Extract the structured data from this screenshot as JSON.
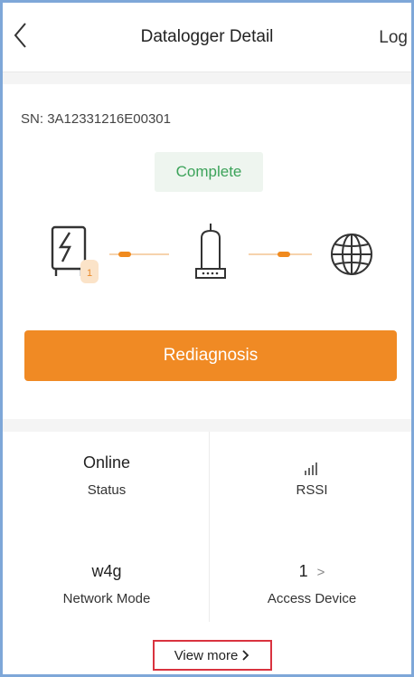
{
  "header": {
    "title": "Datalogger Detail",
    "right_action": "Log",
    "back_icon": "chevron-left-icon"
  },
  "device": {
    "sn_label": "SN:",
    "sn_value": "3A12331216E00301",
    "status_badge": "Complete"
  },
  "diagram": {
    "inverter_icon": "inverter-icon",
    "inverter_badge": "1",
    "datalogger_icon": "datalogger-icon",
    "internet_icon": "globe-icon"
  },
  "actions": {
    "rediagnosis": "Rediagnosis",
    "view_more": "View more",
    "view_more_icon": "chevron-right-icon"
  },
  "info_grid": [
    {
      "value": "Online",
      "label": "Status"
    },
    {
      "value": "",
      "label": "RSSI",
      "icon": "signal-strength-icon"
    },
    {
      "value": "w4g",
      "label": "Network Mode"
    },
    {
      "value": "1",
      "label": "Access Device",
      "icon": "chevron-right-icon"
    }
  ],
  "colors": {
    "accent": "#f08a24",
    "status_green": "#3ca35a",
    "highlight_box": "#d9333f"
  }
}
